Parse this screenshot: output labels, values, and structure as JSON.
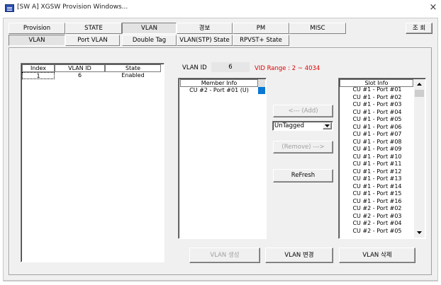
{
  "window": {
    "title": "[SW A] XGSW Provision Windows...",
    "close_glyph": "×"
  },
  "main_tabs": [
    {
      "label": "Provision"
    },
    {
      "label": "STATE"
    },
    {
      "label": "VLAN"
    },
    {
      "label": "경보"
    },
    {
      "label": "PM"
    },
    {
      "label": "MISC"
    }
  ],
  "query_button": "조 회",
  "sub_tabs": [
    {
      "label": "VLAN"
    },
    {
      "label": "Port VLAN"
    },
    {
      "label": "Double Tag"
    },
    {
      "label": "VLAN(STP) State"
    },
    {
      "label": "RPVST+ State"
    }
  ],
  "vlan_table": {
    "columns": [
      "Index",
      "VLAN ID",
      "State"
    ],
    "rows": [
      {
        "index": "1",
        "vlan_id": "6",
        "state": "Enabled"
      }
    ]
  },
  "vlan_id": {
    "label": "VLAN ID",
    "value": "6",
    "range_text": "VID Range : 2 ~ 4034",
    "range_color": "#e00000"
  },
  "member_info": {
    "header": "Member Info",
    "items": [
      "CU #2 - Port #01 (U)"
    ]
  },
  "add_button": "<--- (Add)",
  "tag_select": {
    "value": "UnTagged"
  },
  "remove_button": "(Remove) --->",
  "refresh_button": "ReFresh",
  "slot_info": {
    "header": "Slot Info",
    "items": [
      "CU #1 - Port #01",
      "CU #1 - Port #02",
      "CU #1 - Port #03",
      "CU #1 - Port #04",
      "CU #1 - Port #05",
      "CU #1 - Port #06",
      "CU #1 - Port #07",
      "CU #1 - Port #08",
      "CU #1 - Port #09",
      "CU #1 - Port #10",
      "CU #1 - Port #11",
      "CU #1 - Port #12",
      "CU #1 - Port #13",
      "CU #1 - Port #14",
      "CU #1 - Port #15",
      "CU #1 - Port #16",
      "CU #2 - Port #02",
      "CU #2 - Port #03",
      "CU #2 - Port #04",
      "CU #2 - Port #05"
    ]
  },
  "bottom_buttons": {
    "create": "VLAN 생성",
    "modify": "VLAN 변경",
    "delete": "VLAN 삭제"
  }
}
